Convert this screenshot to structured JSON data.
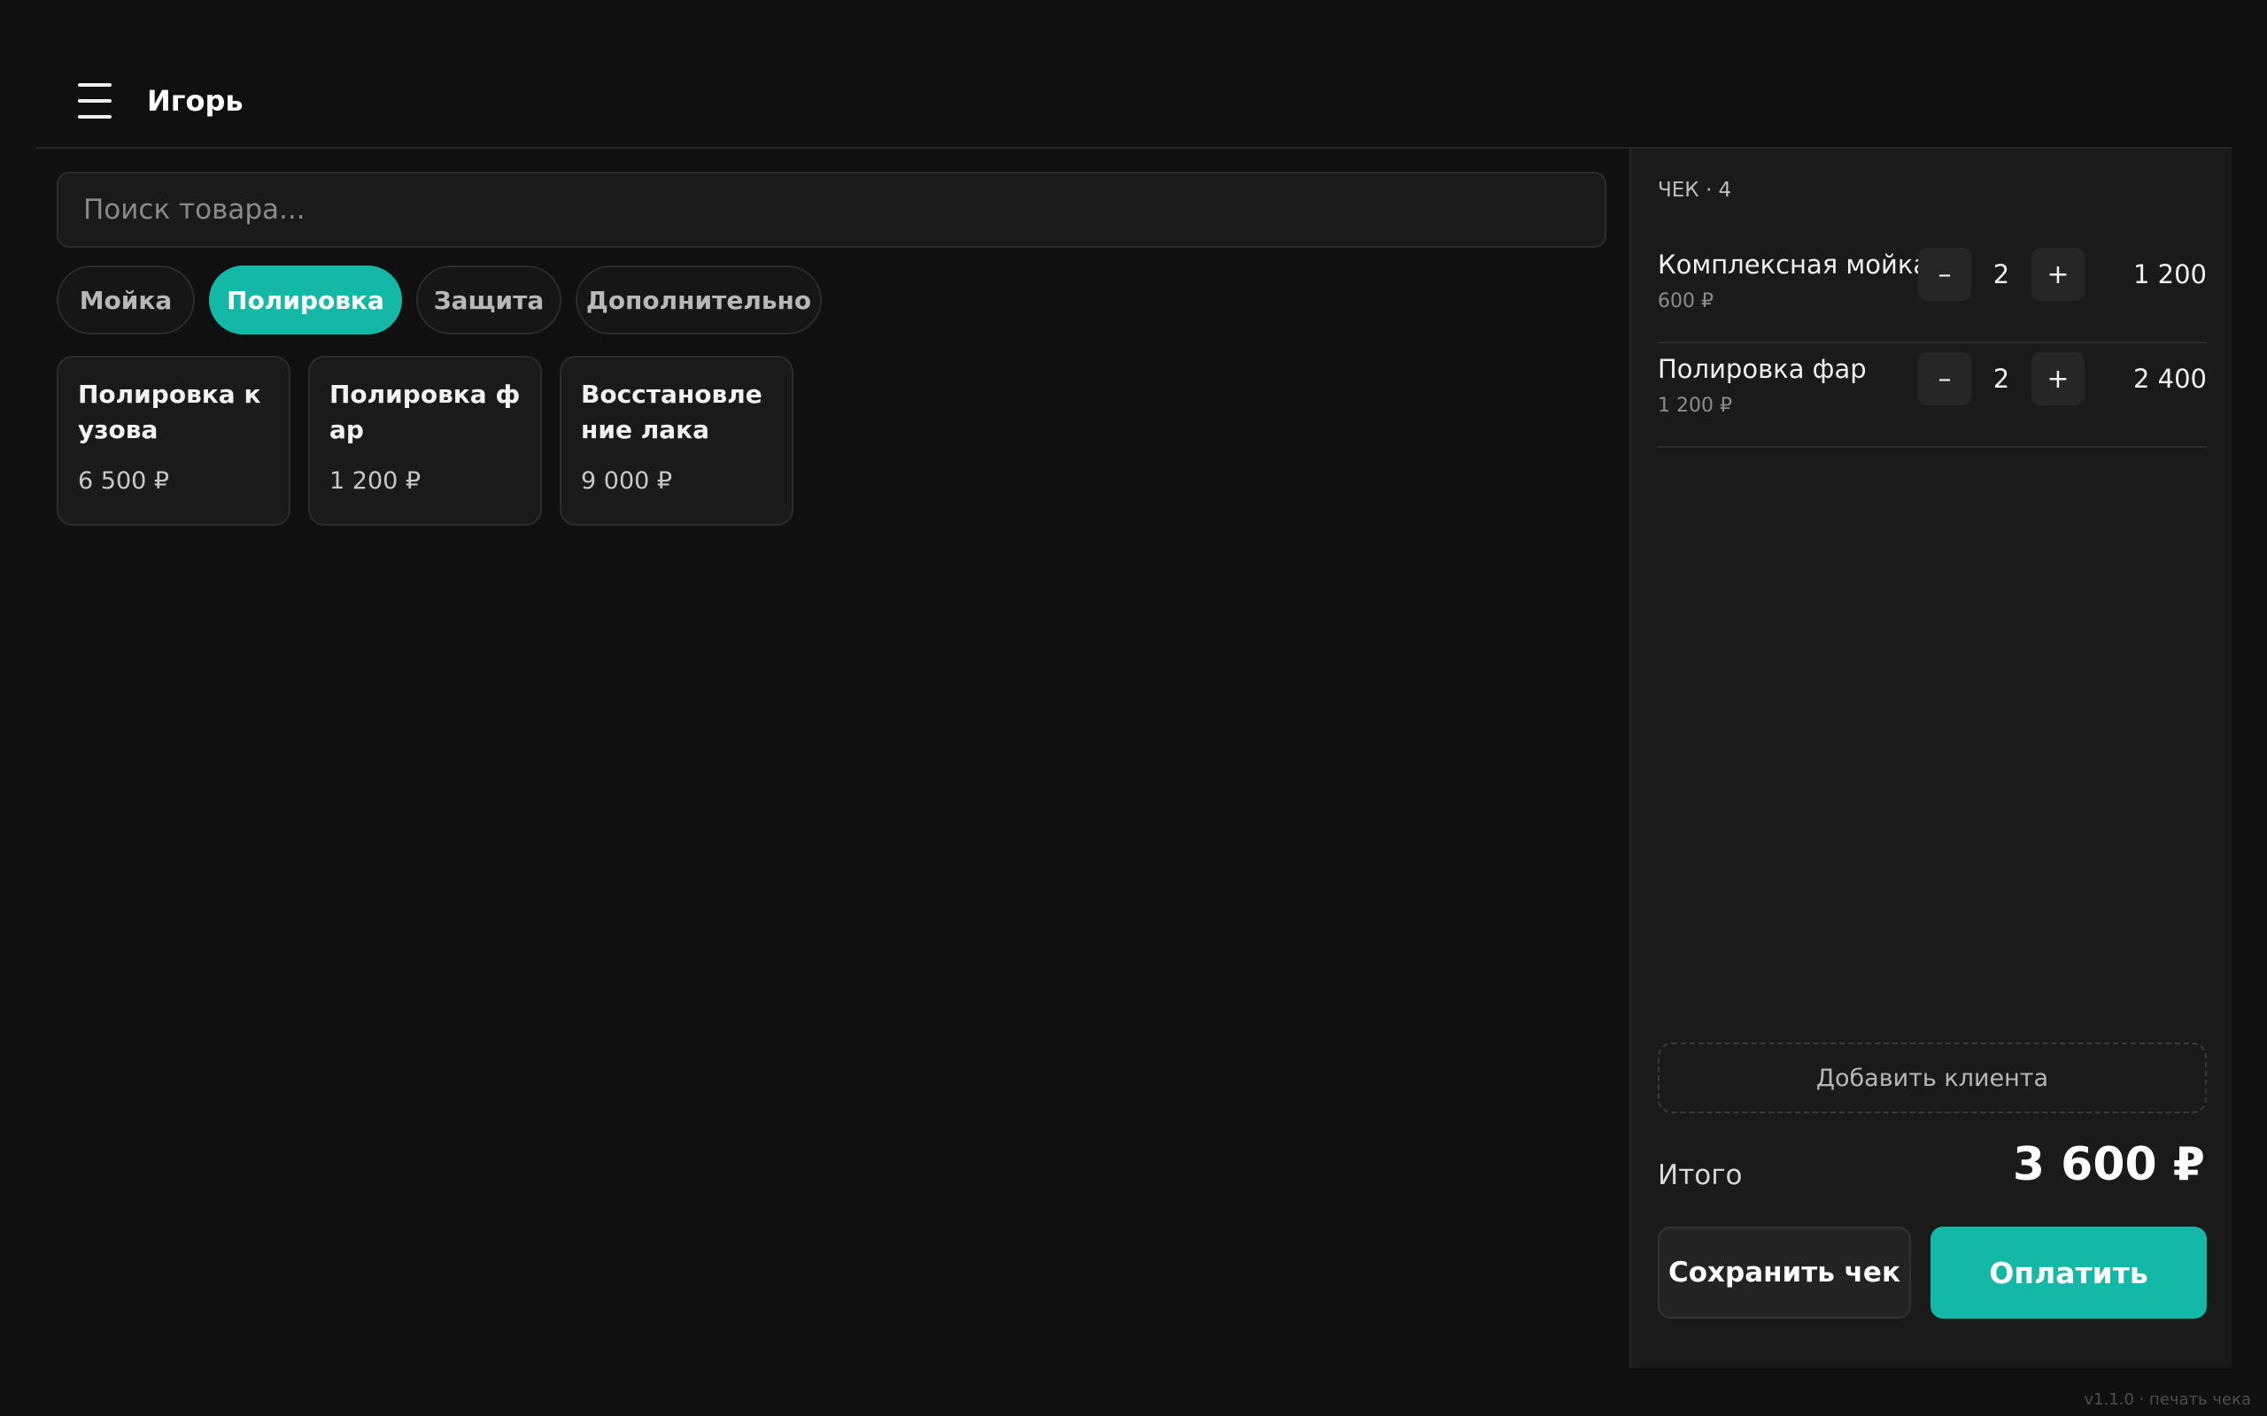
{
  "header": {
    "user_name": "Игорь",
    "menu_icon": "hamburger-menu-icon"
  },
  "search": {
    "placeholder": "Поиск товара..."
  },
  "categories": [
    {
      "label": "Мойка",
      "active": false
    },
    {
      "label": "Полировка",
      "active": true
    },
    {
      "label": "Защита",
      "active": false
    },
    {
      "label": "Дополнительно",
      "active": false
    }
  ],
  "products": [
    {
      "name": "Полировка кузова",
      "price": "6 500 ₽"
    },
    {
      "name": "Полировка фар",
      "price": "1 200 ₽"
    },
    {
      "name": "Восстановление лака",
      "price": "9 000 ₽"
    }
  ],
  "receipt": {
    "title": "ЧЕК · 4",
    "lines": [
      {
        "name": "Комплексная мойка",
        "unit_price": "600 ₽",
        "qty": "2",
        "total": "1 200",
        "minus": "–",
        "plus": "+"
      },
      {
        "name": "Полировка фар",
        "unit_price": "1 200 ₽",
        "qty": "2",
        "total": "2 400",
        "minus": "–",
        "plus": "+"
      }
    ],
    "add_client_label": "Добавить клиента",
    "total_label": "Итого",
    "total_value": "3 600 ₽",
    "save_label": "Сохранить чек",
    "pay_label": "Оплатить"
  },
  "footer": {
    "version": "v1.1.0 · печать чека"
  },
  "colors": {
    "accent": "#14b8a6",
    "background": "#101010",
    "panel": "#1a1a1a"
  }
}
